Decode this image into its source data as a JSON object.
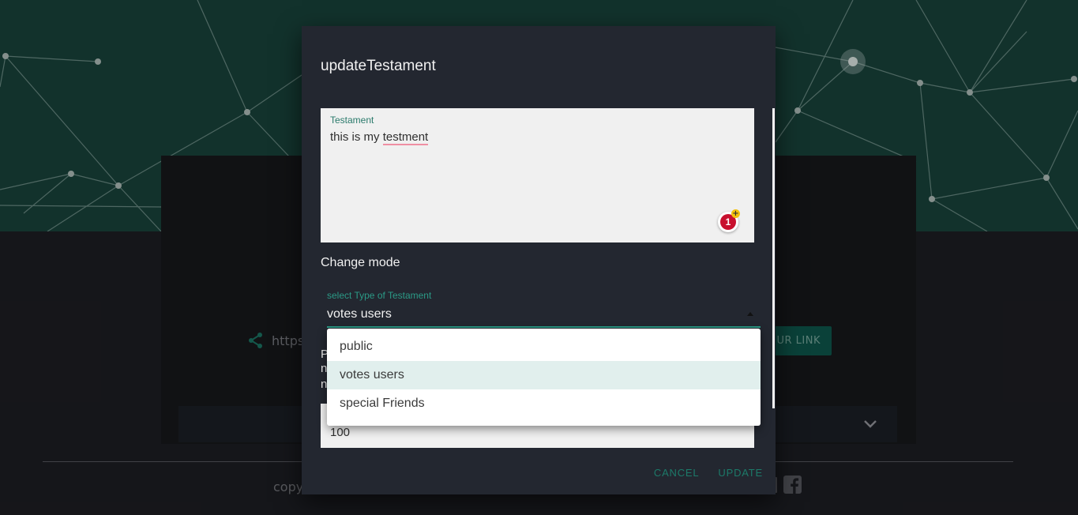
{
  "colors": {
    "accent": "#2b9a86",
    "hero": "#19463e",
    "dialog": "#232730",
    "selected_option": "#e1efed"
  },
  "background": {
    "share_icon": "share-icon",
    "share_url": "https",
    "link_button_label": "UR LINK",
    "chevron_icon": "chevron-down-icon",
    "copyright_text": "copy",
    "facebook_icon": "facebook-icon"
  },
  "dialog": {
    "title": "updateTestament",
    "testament": {
      "label": "Testament",
      "text_before": "this is my ",
      "misspelled_word": "testment",
      "badge_count": "1"
    },
    "change_mode_label": "Change mode",
    "select": {
      "label": "select Type of Testament",
      "value": "votes users",
      "options": [
        "public",
        "votes users",
        "special Friends"
      ]
    },
    "hidden_text_fragments": [
      "P",
      "n",
      "n"
    ],
    "number_value": "100",
    "actions": {
      "cancel": "CANCEL",
      "update": "UPDATE"
    }
  }
}
